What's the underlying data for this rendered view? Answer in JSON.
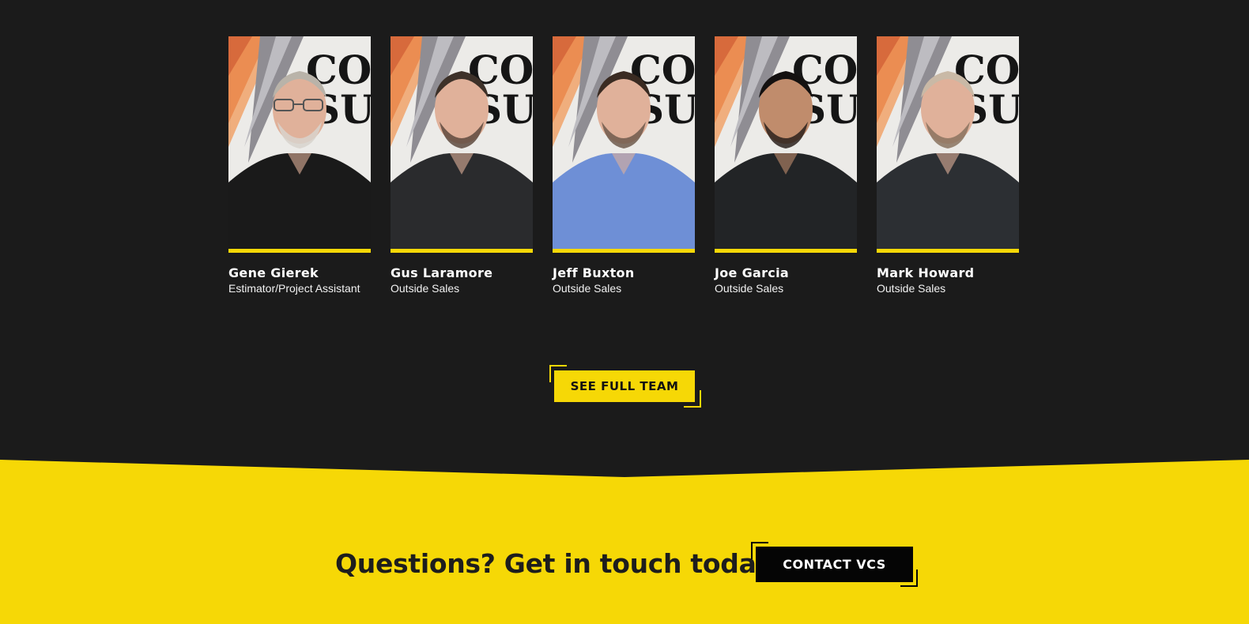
{
  "team": [
    {
      "name": "Gene Gierek",
      "role": "Estimator/Project Assistant",
      "shirt": "#1a1a1a",
      "hair": "#b9b3a9",
      "beard": "#d8d4cc",
      "glasses": true
    },
    {
      "name": "Gus Laramore",
      "role": "Outside Sales",
      "shirt": "#2a2b2d",
      "hair": "#3d3129",
      "beard": "#5e4a3e",
      "glasses": false
    },
    {
      "name": "Jeff Buxton",
      "role": "Outside Sales",
      "shirt": "#6e8fd6",
      "hair": "#3a2b22",
      "beard": "#6f5a4c",
      "glasses": false
    },
    {
      "name": "Joe Garcia",
      "role": "Outside Sales",
      "shirt": "#222426",
      "hair": "#141110",
      "beard": "#2b211c",
      "glasses": false
    },
    {
      "name": "Mark Howard",
      "role": "Outside Sales",
      "shirt": "#2c2f33",
      "hair": "#c9b9a6",
      "beard": "#8a735f",
      "glasses": false
    }
  ],
  "see_team_label": "SEE FULL TEAM",
  "cta": {
    "text": "Questions? Get in touch today.",
    "button": "CONTACT VCS"
  },
  "colors": {
    "accent": "#f6d806",
    "dark": "#1b1b1b",
    "black": "#050505"
  }
}
